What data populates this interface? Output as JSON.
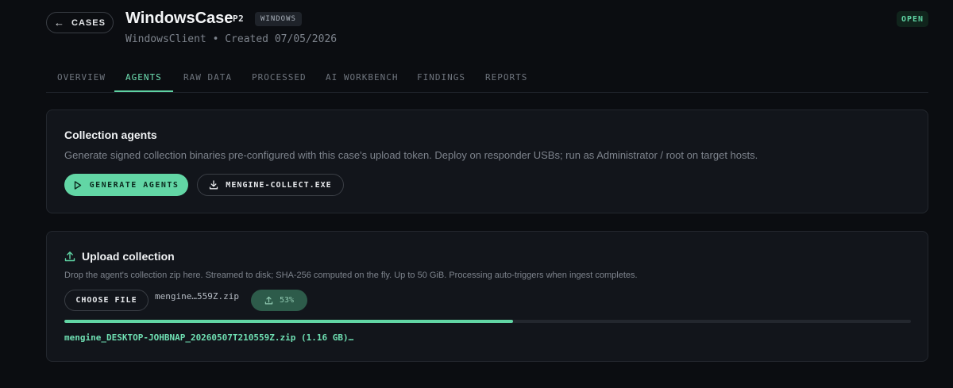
{
  "header": {
    "back_label": "CASES",
    "title": "WindowsCase",
    "priority": "P2",
    "os_badge": "WINDOWS",
    "subtitle": "WindowsClient • Created 07/05/2026",
    "status": "OPEN"
  },
  "tabs": [
    {
      "label": "OVERVIEW",
      "active": false
    },
    {
      "label": "AGENTS",
      "active": true
    },
    {
      "label": "RAW DATA",
      "active": false
    },
    {
      "label": "PROCESSED",
      "active": false
    },
    {
      "label": "AI WORKBENCH",
      "active": false
    },
    {
      "label": "FINDINGS",
      "active": false
    },
    {
      "label": "REPORTS",
      "active": false
    }
  ],
  "agents_card": {
    "title": "Collection agents",
    "description": "Generate signed collection binaries pre-configured with this case's upload token. Deploy on responder USBs; run as Administrator / root on target hosts.",
    "generate_label": "GENERATE AGENTS",
    "download_label": "MENGINE-COLLECT.EXE"
  },
  "upload_card": {
    "title": "Upload collection",
    "description": "Drop the agent's collection zip here. Streamed to disk; SHA-256 computed on the fly. Up to 50 GiB. Processing auto-triggers when ingest completes.",
    "choose_label": "CHOOSE FILE",
    "file_name": "mengine…559Z.zip",
    "progress_label": "53%",
    "progress": 0.53,
    "status_text": "mengine_DESKTOP-JOHBNAP_20260507T210559Z.zip (1.16 GB)…"
  },
  "colors": {
    "accent": "#62d6a5",
    "background": "#0b0d11",
    "card": "#12151b"
  },
  "icons": {
    "back": "arrow-left-icon",
    "generate": "play-icon",
    "download": "download-icon",
    "upload": "upload-icon"
  }
}
